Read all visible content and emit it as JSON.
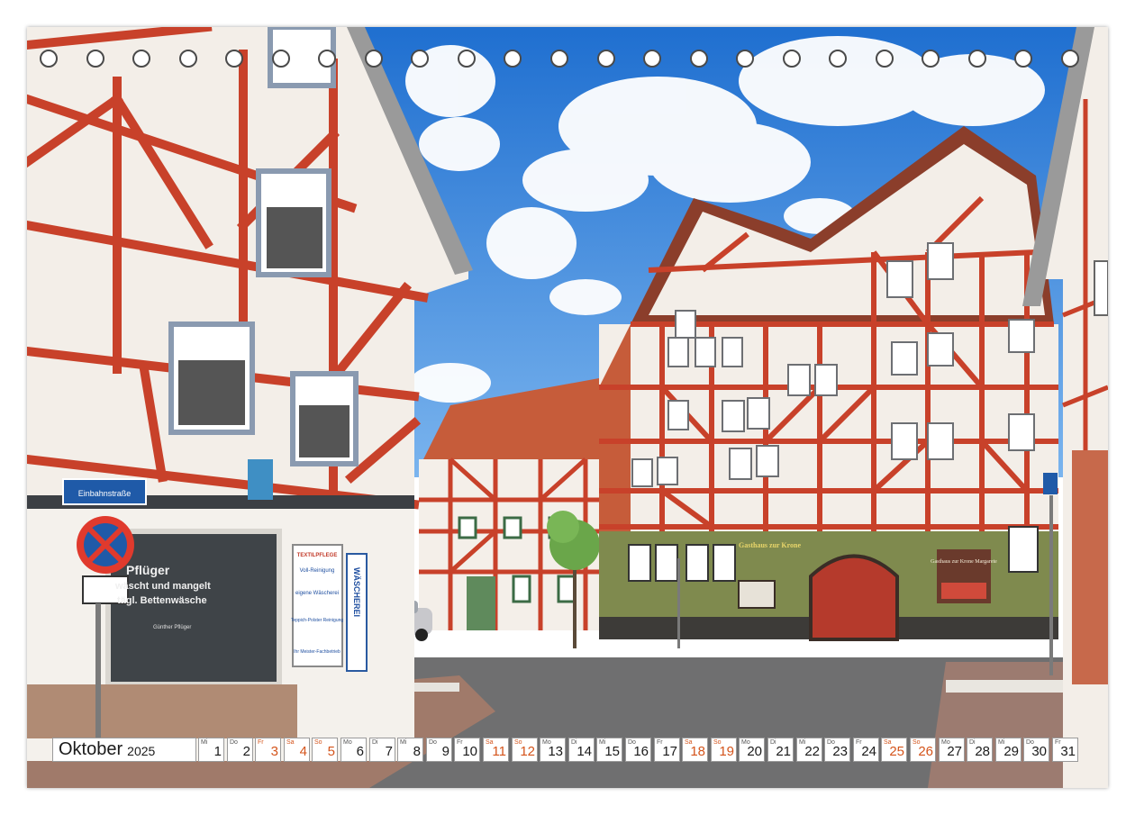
{
  "calendar": {
    "month": "Oktober",
    "year": "2025",
    "days": [
      {
        "wd": "Mi",
        "d": "1",
        "we": false
      },
      {
        "wd": "Do",
        "d": "2",
        "we": false
      },
      {
        "wd": "Fr",
        "d": "3",
        "we": true
      },
      {
        "wd": "Sa",
        "d": "4",
        "we": true
      },
      {
        "wd": "So",
        "d": "5",
        "we": true
      },
      {
        "wd": "Mo",
        "d": "6",
        "we": false
      },
      {
        "wd": "Di",
        "d": "7",
        "we": false
      },
      {
        "wd": "Mi",
        "d": "8",
        "we": false
      },
      {
        "wd": "Do",
        "d": "9",
        "we": false
      },
      {
        "wd": "Fr",
        "d": "10",
        "we": false
      },
      {
        "wd": "Sa",
        "d": "11",
        "we": true
      },
      {
        "wd": "So",
        "d": "12",
        "we": true
      },
      {
        "wd": "Mo",
        "d": "13",
        "we": false
      },
      {
        "wd": "Di",
        "d": "14",
        "we": false
      },
      {
        "wd": "Mi",
        "d": "15",
        "we": false
      },
      {
        "wd": "Do",
        "d": "16",
        "we": false
      },
      {
        "wd": "Fr",
        "d": "17",
        "we": false
      },
      {
        "wd": "Sa",
        "d": "18",
        "we": true
      },
      {
        "wd": "So",
        "d": "19",
        "we": true
      },
      {
        "wd": "Mo",
        "d": "20",
        "we": false
      },
      {
        "wd": "Di",
        "d": "21",
        "we": false
      },
      {
        "wd": "Mi",
        "d": "22",
        "we": false
      },
      {
        "wd": "Do",
        "d": "23",
        "we": false
      },
      {
        "wd": "Fr",
        "d": "24",
        "we": false
      },
      {
        "wd": "Sa",
        "d": "25",
        "we": true
      },
      {
        "wd": "So",
        "d": "26",
        "we": true
      },
      {
        "wd": "Mo",
        "d": "27",
        "we": false
      },
      {
        "wd": "Di",
        "d": "28",
        "we": false
      },
      {
        "wd": "Mi",
        "d": "29",
        "we": false
      },
      {
        "wd": "Do",
        "d": "30",
        "we": false
      },
      {
        "wd": "Fr",
        "d": "31",
        "we": false
      }
    ]
  },
  "signs": {
    "street_sign": "Einbahnstraße",
    "shop_name": "Pflüger",
    "shop_slogan": "wäscht und mangelt",
    "shop_line3": "tägl. Bettenwäsche",
    "shop_owner": "Günther Pflüger",
    "vertical_sign": "WÄSCHEREI",
    "poster_title": "TEXTILPFLEGE",
    "poster_lines": [
      "Voll-Reinigung",
      "eigene Wäscherei",
      "Teppich-Polster Reinigung",
      "Ihr Meister-Fachbetrieb"
    ],
    "inn_left": "Gasthaus zur Krone",
    "inn_right": "Gasthaus zur Krone Margarete"
  },
  "colors": {
    "timber": "#c8412a",
    "plaster": "#f1eeea",
    "sky": "#2e7fd6",
    "weekend": "#d4541b"
  }
}
